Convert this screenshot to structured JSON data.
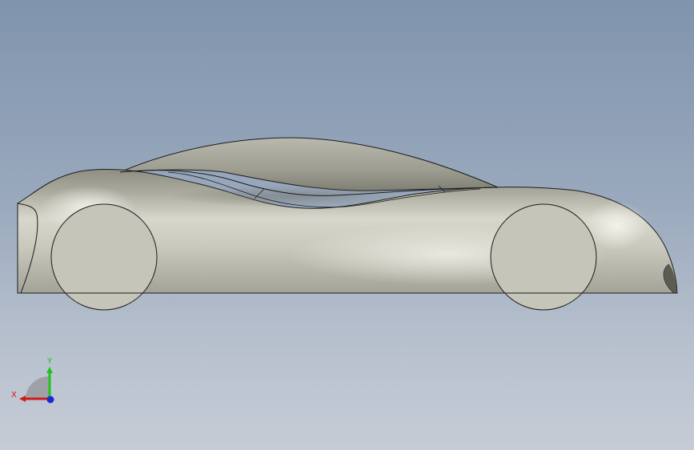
{
  "viewport": {
    "background_top": "#7f94ad",
    "background_bottom": "#c6ccd6"
  },
  "model": {
    "body_color": "#c9c9bd",
    "shadow_color": "#8e8e82",
    "highlight_color": "#f4f4ec",
    "edge_color": "#1c1c1c",
    "wheel_color": "#c5c5ba"
  },
  "triad": {
    "x_label": "X",
    "y_label": "Y",
    "x_color": "#d01a1a",
    "y_color": "#1cc41c",
    "z_color": "#1a2ad0"
  }
}
